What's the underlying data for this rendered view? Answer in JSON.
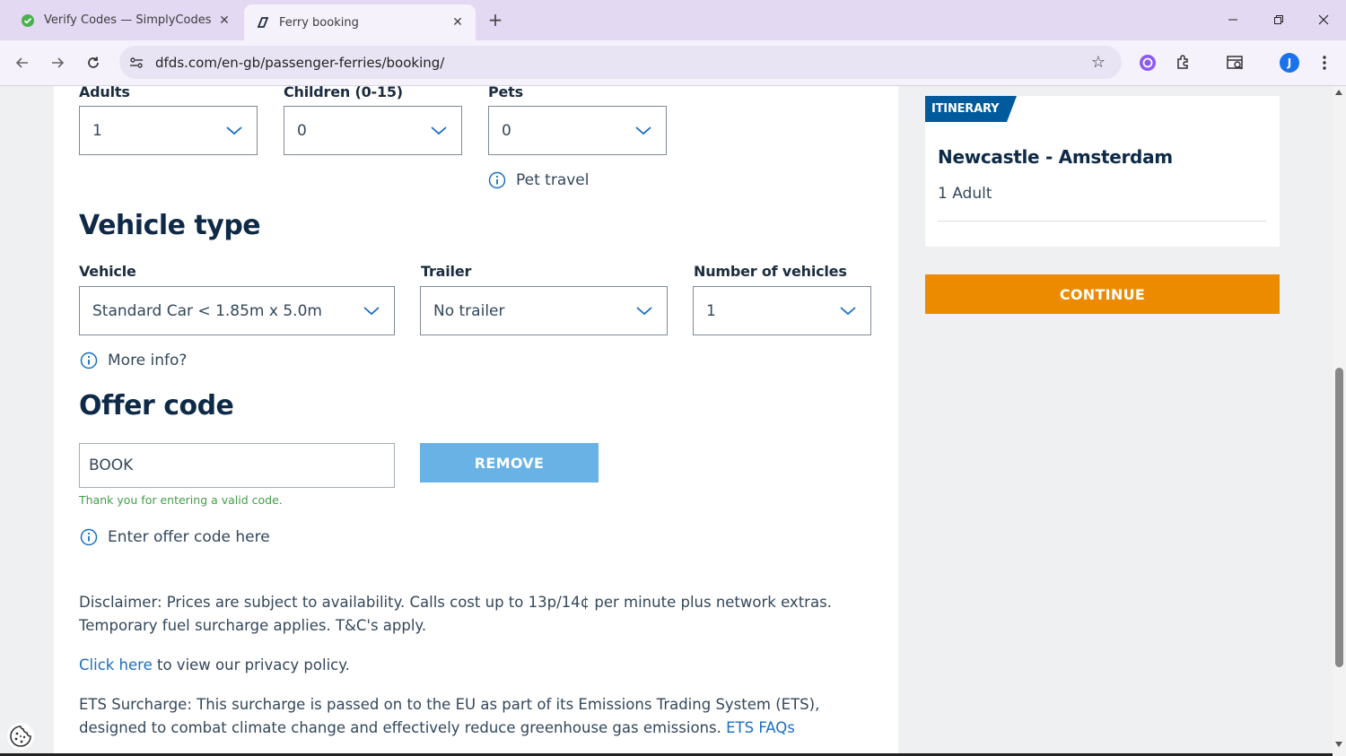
{
  "browser": {
    "tabs": [
      {
        "title": "Verify Codes — SimplyCodes",
        "active": false,
        "icon": "simplycodes-icon"
      },
      {
        "title": "Ferry booking",
        "active": true,
        "icon": "dfds-icon"
      }
    ],
    "url": "dfds.com/en-gb/passenger-ferries/booking/",
    "profile_initial": "J"
  },
  "passengers": {
    "adults_label": "Adults",
    "adults_value": "1",
    "children_label": "Children (0-15)",
    "children_value": "0",
    "pets_label": "Pets",
    "pets_value": "0",
    "pet_travel_info": "Pet travel"
  },
  "vehicle": {
    "heading": "Vehicle type",
    "vehicle_label": "Vehicle",
    "vehicle_value": "Standard Car < 1.85m x 5.0m",
    "trailer_label": "Trailer",
    "trailer_value": "No trailer",
    "number_label": "Number of vehicles",
    "number_value": "1",
    "more_info": "More info?"
  },
  "offer": {
    "heading": "Offer code",
    "code_value": "BOOK",
    "remove_label": "REMOVE",
    "valid_message": "Thank you for entering a valid code.",
    "enter_info": "Enter offer code here"
  },
  "footer": {
    "disclaimer": "Disclaimer: Prices are subject to availability. Calls cost up to 13p/14¢ per minute plus network extras. Temporary fuel surcharge applies. T&C's apply.",
    "privacy_link": "Click here",
    "privacy_text": " to view our privacy policy.",
    "ets_text": "ETS Surcharge: This surcharge is passed on to the EU as part of its Emissions Trading System (ETS), designed to combat climate change and effectively reduce greenhouse gas emissions. ",
    "ets_link": "ETS FAQs"
  },
  "itinerary": {
    "tag": "ITINERARY",
    "route": "Newcastle - Amsterdam",
    "passengers": "1 Adult",
    "continue_label": "CONTINUE"
  },
  "colors": {
    "brand_navy": "#0e2a47",
    "tag_blue": "#005a9c",
    "continue_orange": "#ed8b00",
    "remove_blue": "#69b2e5",
    "valid_green": "#3f9e47",
    "link_blue": "#1a6ec2"
  }
}
